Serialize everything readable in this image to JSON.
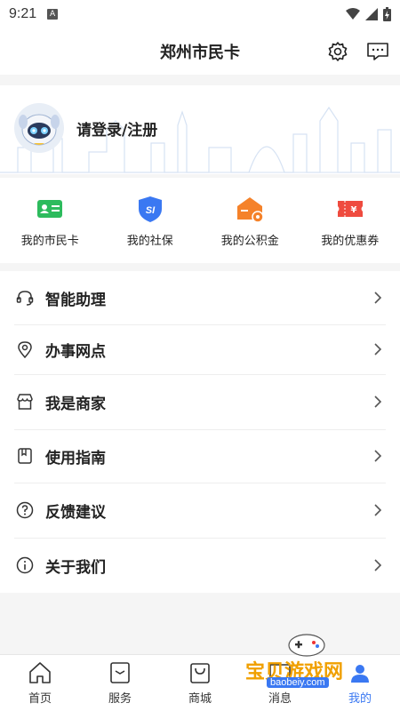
{
  "status_bar": {
    "time": "9:21",
    "notification_icon": "A"
  },
  "header": {
    "title": "郑州市民卡",
    "settings_icon": "gear-icon",
    "message_icon": "message-icon"
  },
  "profile": {
    "login_text": "请登录/注册"
  },
  "quick_actions": [
    {
      "label": "我的市民卡",
      "icon": "citizen-card-icon",
      "color": "#2dbb5d"
    },
    {
      "label": "我的社保",
      "icon": "social-security-icon",
      "color": "#3a78f2"
    },
    {
      "label": "我的公积金",
      "icon": "housing-fund-icon",
      "color": "#f5822a"
    },
    {
      "label": "我的优惠券",
      "icon": "coupon-icon",
      "color": "#ef4b3f"
    }
  ],
  "menu": [
    {
      "label": "智能助理",
      "icon": "headset-icon"
    },
    {
      "label": "办事网点",
      "icon": "location-pin-icon"
    },
    {
      "label": "我是商家",
      "icon": "store-icon"
    },
    {
      "label": "使用指南",
      "icon": "guide-book-icon"
    },
    {
      "label": "反馈建议",
      "icon": "question-icon"
    },
    {
      "label": "关于我们",
      "icon": "info-icon"
    }
  ],
  "tabbar": [
    {
      "label": "首页",
      "icon": "home-icon"
    },
    {
      "label": "服务",
      "icon": "service-icon"
    },
    {
      "label": "商城",
      "icon": "shop-bag-icon"
    },
    {
      "label": "消息",
      "icon": "message-tab-icon"
    },
    {
      "label": "我的",
      "icon": "profile-icon",
      "active": true
    }
  ],
  "watermark": {
    "text": "宝贝游戏网",
    "url": "baobeiy.com"
  },
  "colors": {
    "accent": "#3a78f2",
    "background": "#f5f5f5"
  }
}
